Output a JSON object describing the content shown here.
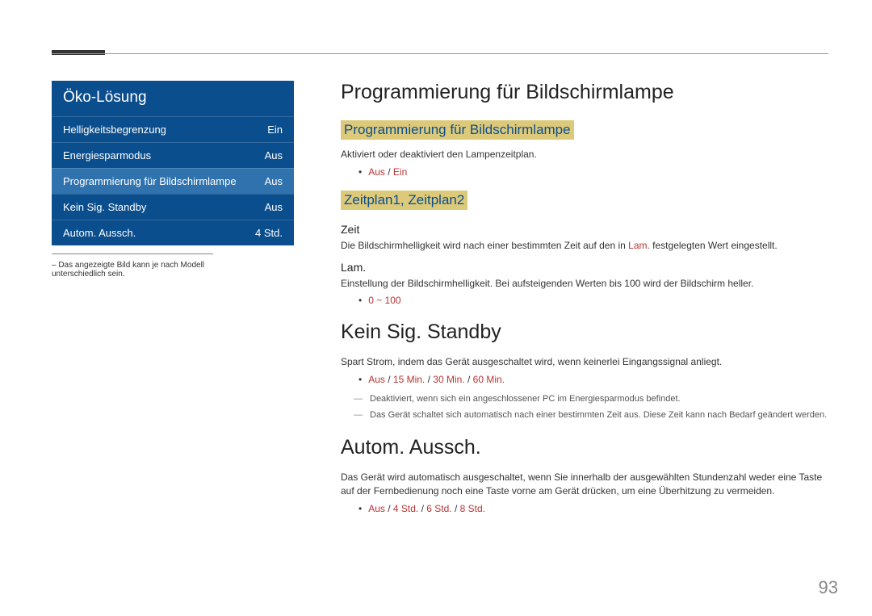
{
  "menu": {
    "title": "Öko-Lösung",
    "rows": [
      {
        "label": "Helligkeitsbegrenzung",
        "value": "Ein"
      },
      {
        "label": "Energiesparmodus",
        "value": "Aus"
      },
      {
        "label": "Programmierung für Bildschirmlampe",
        "value": "Aus"
      },
      {
        "label": "Kein Sig. Standby",
        "value": "Aus"
      },
      {
        "label": "Autom. Aussch.",
        "value": "4 Std."
      }
    ],
    "footnote": "– Das angezeigte Bild kann je nach Modell unterschiedlich sein."
  },
  "content": {
    "s1": {
      "title": "Programmierung für Bildschirmlampe",
      "sub1": "Programmierung für Bildschirmlampe",
      "desc1": "Aktiviert oder deaktiviert den Lampenzeitplan.",
      "opt1a": "Aus",
      "opt1b": "Ein",
      "sub2": "Zeitplan1, Zeitplan2",
      "h4a": "Zeit",
      "desc2a": "Die Bildschirmhelligkeit wird nach einer bestimmten Zeit auf den in ",
      "desc2b": "Lam.",
      "desc2c": " festgelegten Wert eingestellt.",
      "h4b": "Lam.",
      "desc3": "Einstellung der Bildschirmhelligkeit. Bei aufsteigenden Werten bis 100 wird der Bildschirm heller.",
      "opt2": "0 ~ 100"
    },
    "s2": {
      "title": "Kein Sig. Standby",
      "desc": "Spart Strom, indem das Gerät ausgeschaltet wird, wenn keinerlei Eingangssignal anliegt.",
      "o1": "Aus",
      "o2": "15 Min.",
      "o3": "30 Min.",
      "o4": "60 Min.",
      "note1": "Deaktiviert, wenn sich ein angeschlossener PC im Energiesparmodus befindet.",
      "note2": "Das Gerät schaltet sich automatisch nach einer bestimmten Zeit aus. Diese Zeit kann nach Bedarf geändert werden."
    },
    "s3": {
      "title": "Autom. Aussch.",
      "desc": "Das Gerät wird automatisch ausgeschaltet, wenn Sie innerhalb der ausgewählten Stundenzahl weder eine Taste auf der Fernbedienung noch eine Taste vorne am Gerät drücken, um eine Überhitzung zu vermeiden.",
      "o1": "Aus",
      "o2": "4 Std.",
      "o3": "6 Std.",
      "o4": "8 Std."
    }
  },
  "pageNumber": "93"
}
